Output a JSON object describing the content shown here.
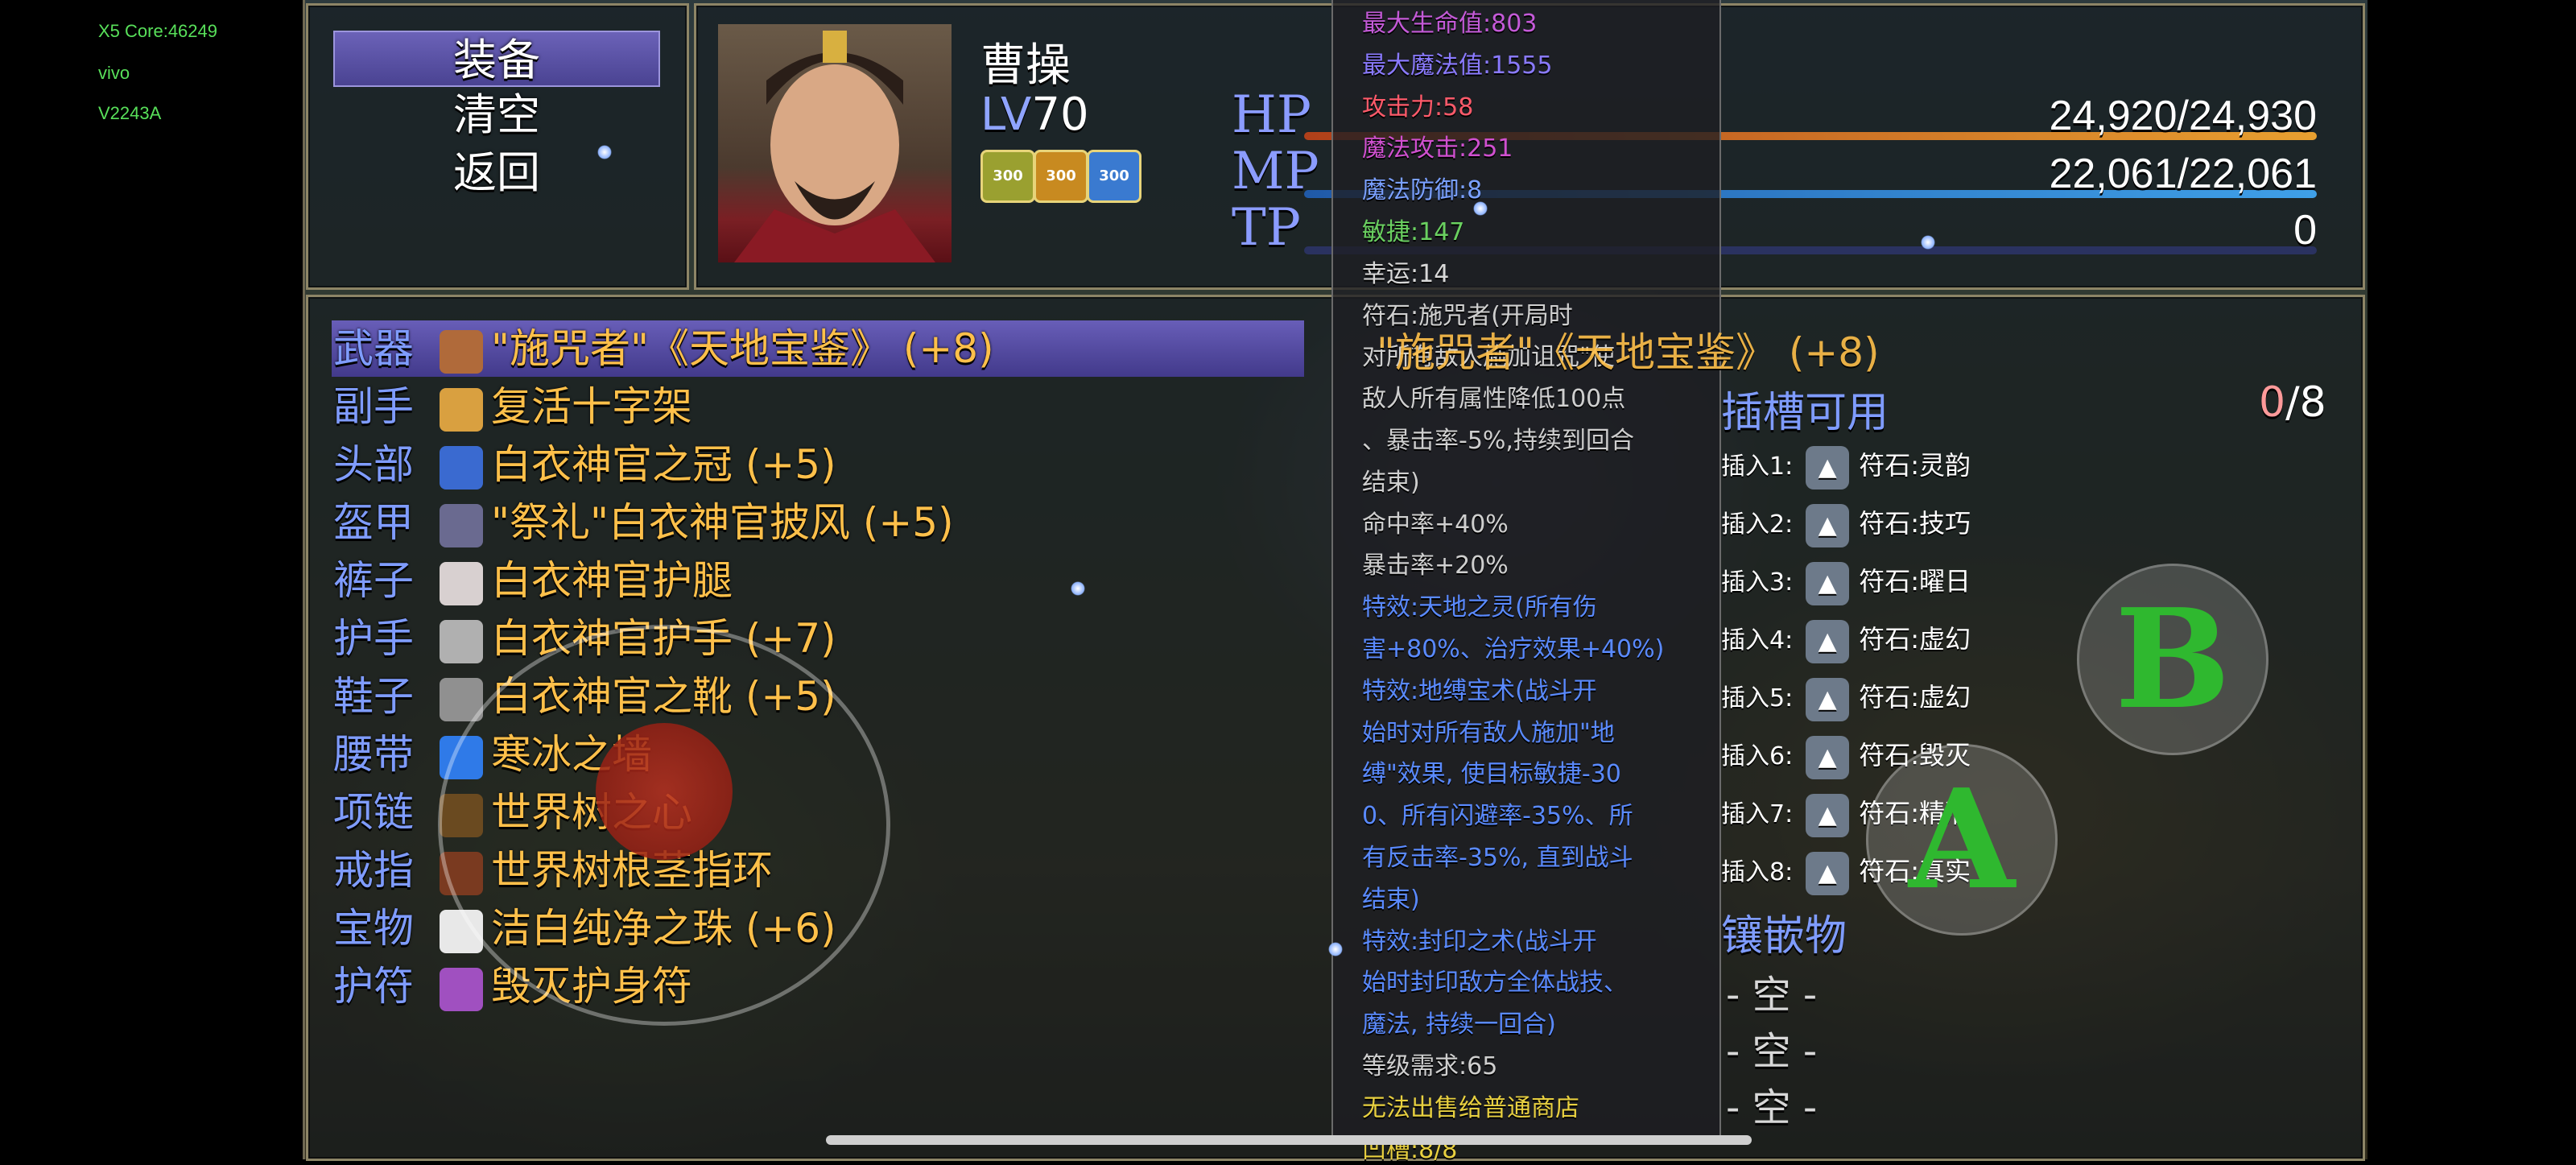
{
  "debug": [
    "X5 Core:46249",
    "vivo",
    "V2243A"
  ],
  "menu": {
    "equip": "装备",
    "clear": "清空",
    "back": "返回"
  },
  "hero": {
    "name": "曹操",
    "lv_label": "LV",
    "lv": "70",
    "badges": [
      "300",
      "300",
      "300"
    ]
  },
  "stats": [
    {
      "label": "HP",
      "value": "24,920/24,930",
      "color": "#e8a030"
    },
    {
      "label": "MP",
      "value": "22,061/22,061",
      "color": "#3fa0e8"
    },
    {
      "label": "TP",
      "value": "0",
      "color": "#404a80"
    }
  ],
  "equipment": [
    {
      "slot": "武器",
      "item": "\"施咒者\"《天地宝鉴》 (+8)",
      "icon": "book-icon",
      "color": "#b06a3a"
    },
    {
      "slot": "副手",
      "item": "复活十字架",
      "icon": "cross-icon",
      "color": "#d9a040"
    },
    {
      "slot": "头部",
      "item": "白衣神官之冠 (+5)",
      "icon": "crown-icon",
      "color": "#3a6ad0"
    },
    {
      "slot": "盔甲",
      "item": "\"祭礼\"白衣神官披风 (+5)",
      "icon": "cloak-icon",
      "color": "#6a6a90"
    },
    {
      "slot": "裤子",
      "item": "白衣神官护腿",
      "icon": "leggings-icon",
      "color": "#d8d0d0"
    },
    {
      "slot": "护手",
      "item": "白衣神官护手 (+7)",
      "icon": "gauntlet-icon",
      "color": "#b0b0b0"
    },
    {
      "slot": "鞋子",
      "item": "白衣神官之靴 (+5)",
      "icon": "boots-icon",
      "color": "#909090"
    },
    {
      "slot": "腰带",
      "item": "寒冰之墙",
      "icon": "belt-icon",
      "color": "#2f7ae8"
    },
    {
      "slot": "项链",
      "item": "世界树之心",
      "icon": "necklace-icon",
      "color": "#6a4a20"
    },
    {
      "slot": "戒指",
      "item": "世界树根茎指环",
      "icon": "ring-icon",
      "color": "#7a3a20"
    },
    {
      "slot": "宝物",
      "item": "洁白纯净之珠 (+6)",
      "icon": "pearl-icon",
      "color": "#e8e8e8"
    },
    {
      "slot": "护符",
      "item": "毁灭护身符",
      "icon": "amulet-icon",
      "color": "#a050c0"
    }
  ],
  "tooltip": [
    {
      "t": "最大生命值:803",
      "c": "#c45ad8"
    },
    {
      "t": "最大魔法值:1555",
      "c": "#8a7aff"
    },
    {
      "t": "攻击力:58",
      "c": "#ff5a6a"
    },
    {
      "t": "魔法攻击:251",
      "c": "#d050d0"
    },
    {
      "t": "魔法防御:8",
      "c": "#7aa0ff"
    },
    {
      "t": "敏捷:147",
      "c": "#6ad060"
    },
    {
      "t": "幸运:14",
      "c": "#d8d8d8"
    },
    {
      "t": "符石:施咒者(开局时",
      "c": "#cfcfcf"
    },
    {
      "t": "对所有敌人施加诅咒\"使",
      "c": "#cfcfcf"
    },
    {
      "t": "敌人所有属性降低100点",
      "c": "#cfcfcf"
    },
    {
      "t": "、暴击率-5%,持续到回合",
      "c": "#cfcfcf"
    },
    {
      "t": "结束)",
      "c": "#cfcfcf"
    },
    {
      "t": "命中率+40%",
      "c": "#cfcfcf"
    },
    {
      "t": "暴击率+20%",
      "c": "#cfcfcf"
    },
    {
      "t": "特效:天地之灵(所有伤",
      "c": "#5a8aff"
    },
    {
      "t": "害+80%、治疗效果+40%)",
      "c": "#5a8aff"
    },
    {
      "t": "特效:地缚宝术(战斗开",
      "c": "#5a8aff"
    },
    {
      "t": "始时对所有敌人施加\"地",
      "c": "#5a8aff"
    },
    {
      "t": "缚\"效果, 使目标敏捷-30",
      "c": "#5a8aff"
    },
    {
      "t": "0、所有闪避率-35%、所",
      "c": "#5a8aff"
    },
    {
      "t": "有反击率-35%, 直到战斗",
      "c": "#5a8aff"
    },
    {
      "t": "结束)",
      "c": "#5a8aff"
    },
    {
      "t": "特效:封印之术(战斗开",
      "c": "#5a8aff"
    },
    {
      "t": "始时封印敌方全体战技、",
      "c": "#5a8aff"
    },
    {
      "t": "魔法, 持续一回合)",
      "c": "#5a8aff"
    },
    {
      "t": "等级需求:65",
      "c": "#cfcfcf"
    },
    {
      "t": "无法出售给普通商店",
      "c": "#e8d040"
    },
    {
      "t": "凹槽:8/8",
      "c": "#e8d040"
    }
  ],
  "weapon_header": "\"施咒者\"《天地宝鉴》 (+8)",
  "sockets": {
    "title": "插槽可用",
    "count_used": "0",
    "count_total": "/8",
    "items": [
      {
        "label": "插入1:",
        "name": "符石:灵韵",
        "icon": "rune-spirit-icon"
      },
      {
        "label": "插入2:",
        "name": "符石:技巧",
        "icon": "rune-skill-icon"
      },
      {
        "label": "插入3:",
        "name": "符石:曜日",
        "icon": "rune-triangle-icon"
      },
      {
        "label": "插入4:",
        "name": "符石:虚幻",
        "icon": "rune-triangle-icon"
      },
      {
        "label": "插入5:",
        "name": "符石:虚幻",
        "icon": "rune-triangle-icon"
      },
      {
        "label": "插入6:",
        "name": "符石:毁灭",
        "icon": "rune-triangle-icon"
      },
      {
        "label": "插入7:",
        "name": "符石:精准",
        "icon": "rune-precision-icon"
      },
      {
        "label": "插入8:",
        "name": "符石:真实",
        "icon": "rune-triangle-icon"
      }
    ]
  },
  "inlay": {
    "title": "镶嵌物",
    "empty": [
      "- 空 -",
      "- 空 -",
      "- 空 -"
    ]
  },
  "buttons": {
    "b": "B",
    "a": "A"
  }
}
